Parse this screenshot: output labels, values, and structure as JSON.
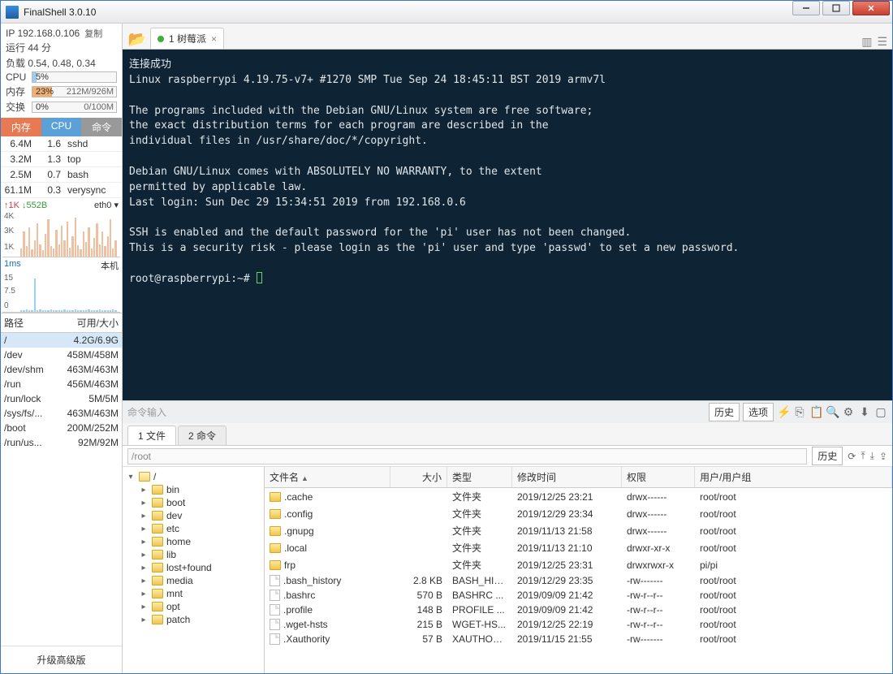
{
  "app_title": "FinalShell 3.0.10",
  "sidebar": {
    "ip_label": "IP 192.168.0.106",
    "copy": "复制",
    "uptime": "运行 44 分",
    "load": "负载 0.54, 0.48, 0.34",
    "cpu_lbl": "CPU",
    "cpu_pct": "5%",
    "mem_lbl": "内存",
    "mem_pct": "23%",
    "mem_txt": "212M/926M",
    "swap_lbl": "交换",
    "swap_pct": "0%",
    "swap_txt": "0/100M",
    "proc_head": [
      "内存",
      "CPU",
      "命令"
    ],
    "procs": [
      [
        "6.4M",
        "1.6",
        "sshd"
      ],
      [
        "3.2M",
        "1.3",
        "top"
      ],
      [
        "2.5M",
        "0.7",
        "bash"
      ],
      [
        "61.1M",
        "0.3",
        "verysync"
      ]
    ],
    "net_up": "↑1K",
    "net_dn": "↓552B",
    "net_if": "eth0 ▾",
    "net_ticks": [
      "4K",
      "3K",
      "1K"
    ],
    "ping_lbl": "1ms",
    "ping_r": "本机",
    "ping_ticks": [
      "15",
      "7.5",
      "0"
    ],
    "disk_head": [
      "路径",
      "可用/大小"
    ],
    "disks": [
      [
        "/",
        "4.2G/6.9G"
      ],
      [
        "/dev",
        "458M/458M"
      ],
      [
        "/dev/shm",
        "463M/463M"
      ],
      [
        "/run",
        "456M/463M"
      ],
      [
        "/run/lock",
        "5M/5M"
      ],
      [
        "/sys/fs/...",
        "463M/463M"
      ],
      [
        "/boot",
        "200M/252M"
      ],
      [
        "/run/us...",
        "92M/92M"
      ]
    ],
    "upgrade": "升级高级版"
  },
  "tab": {
    "label": "1 树莓派"
  },
  "terminal_lines": [
    "连接成功",
    "Linux raspberrypi 4.19.75-v7+ #1270 SMP Tue Sep 24 18:45:11 BST 2019 armv7l",
    "",
    "The programs included with the Debian GNU/Linux system are free software;",
    "the exact distribution terms for each program are described in the",
    "individual files in /usr/share/doc/*/copyright.",
    "",
    "Debian GNU/Linux comes with ABSOLUTELY NO WARRANTY, to the extent",
    "permitted by applicable law.",
    "Last login: Sun Dec 29 15:34:51 2019 from 192.168.0.6",
    "",
    "SSH is enabled and the default password for the 'pi' user has not been changed.",
    "This is a security risk - please login as the 'pi' user and type 'passwd' to set a new password.",
    "",
    "root@raspberrypi:~# "
  ],
  "cmdbar": {
    "hint": "命令输入",
    "history": "历史",
    "options": "选项"
  },
  "bottom_tabs": [
    "1 文件",
    "2 命令"
  ],
  "filepane": {
    "path": "/root",
    "history": "历史",
    "tree_root": "/",
    "tree": [
      "bin",
      "boot",
      "dev",
      "etc",
      "home",
      "lib",
      "lost+found",
      "media",
      "mnt",
      "opt",
      "patch"
    ],
    "cols": [
      "文件名",
      "大小",
      "类型",
      "修改时间",
      "权限",
      "用户/用户组"
    ],
    "rows": [
      [
        ".cache",
        "",
        "文件夹",
        "2019/12/25 23:21",
        "drwx------",
        "root/root",
        "d"
      ],
      [
        ".config",
        "",
        "文件夹",
        "2019/12/29 23:34",
        "drwx------",
        "root/root",
        "d"
      ],
      [
        ".gnupg",
        "",
        "文件夹",
        "2019/11/13 21:58",
        "drwx------",
        "root/root",
        "d"
      ],
      [
        ".local",
        "",
        "文件夹",
        "2019/11/13 21:10",
        "drwxr-xr-x",
        "root/root",
        "d"
      ],
      [
        "frp",
        "",
        "文件夹",
        "2019/12/25 23:31",
        "drwxrwxr-x",
        "pi/pi",
        "d"
      ],
      [
        ".bash_history",
        "2.8 KB",
        "BASH_HIS...",
        "2019/12/29 23:35",
        "-rw-------",
        "root/root",
        "f"
      ],
      [
        ".bashrc",
        "570 B",
        "BASHRC ...",
        "2019/09/09 21:42",
        "-rw-r--r--",
        "root/root",
        "f"
      ],
      [
        ".profile",
        "148 B",
        "PROFILE ...",
        "2019/09/09 21:42",
        "-rw-r--r--",
        "root/root",
        "f"
      ],
      [
        ".wget-hsts",
        "215 B",
        "WGET-HS...",
        "2019/12/25 22:19",
        "-rw-r--r--",
        "root/root",
        "f"
      ],
      [
        ".Xauthority",
        "57 B",
        "XAUTHOR...",
        "2019/11/15 21:55",
        "-rw-------",
        "root/root",
        "f"
      ]
    ]
  }
}
